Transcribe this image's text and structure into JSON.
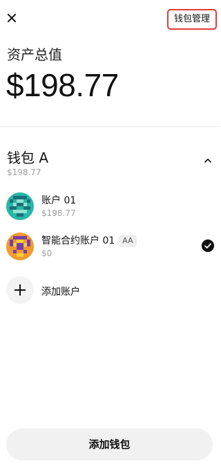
{
  "header": {
    "close_icon": "close-icon",
    "manage_label": "钱包管理",
    "manage_highlight_color": "#e23a3a"
  },
  "summary": {
    "label": "资产总值",
    "total": "$198.77"
  },
  "wallet": {
    "name": "钱包 A",
    "balance": "$198.77",
    "expanded": true,
    "accounts": [
      {
        "name": "账户 01",
        "balance": "$198.77",
        "badge": "",
        "selected": false,
        "avatar": "pixel-avatar-teal"
      },
      {
        "name": "智能合约账户 01",
        "balance": "$0",
        "badge": "AA",
        "selected": true,
        "avatar": "pixel-avatar-orange"
      }
    ],
    "add_account_label": "添加账户"
  },
  "footer": {
    "add_wallet_label": "添加钱包"
  }
}
